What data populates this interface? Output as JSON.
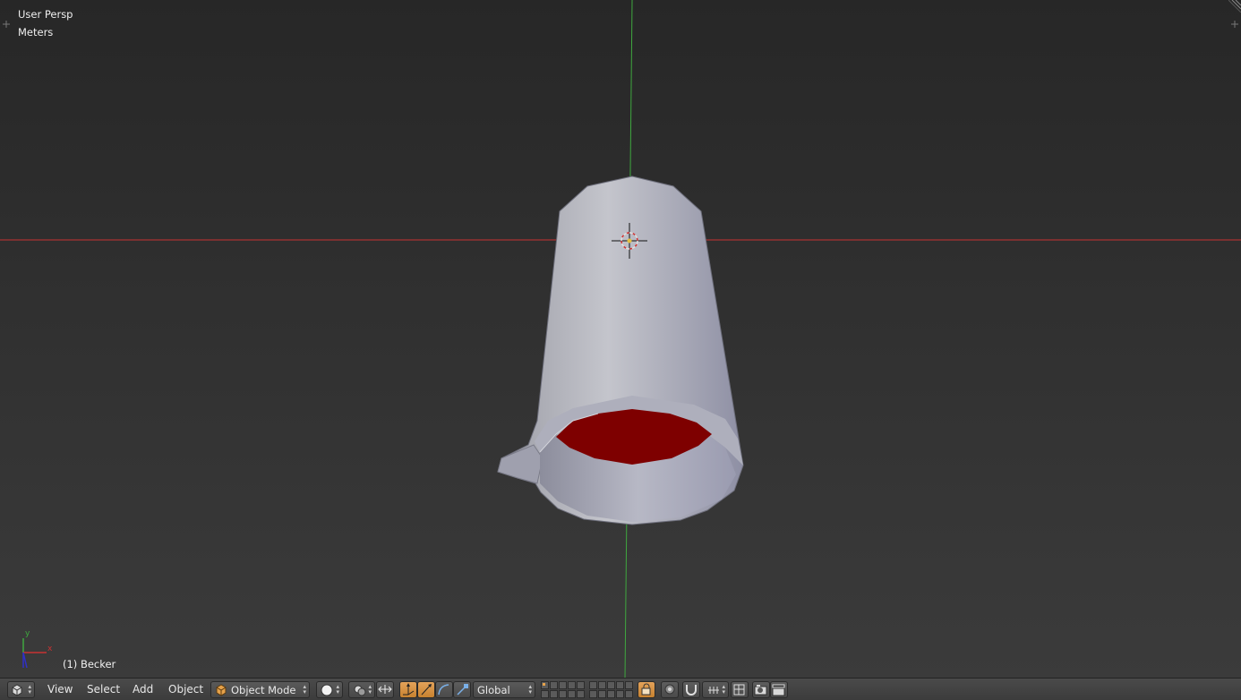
{
  "viewport": {
    "view_label": "User Persp",
    "units_label": "Meters",
    "active_object": "(1) Becker",
    "axis_labels": {
      "x": "x",
      "y": "y"
    }
  },
  "header": {
    "editor_type_icon": "3d-view-icon",
    "menus": [
      "View",
      "Select",
      "Add",
      "Object"
    ],
    "mode": "Object Mode",
    "shading_icon": "solid-sphere-icon",
    "orientation": "Global"
  },
  "colors": {
    "x_axis": "#c83232",
    "y_axis": "#3fa83f",
    "active_toggle": "#d79040",
    "mesh": "#a9aab7",
    "interior": "#7e0000"
  }
}
